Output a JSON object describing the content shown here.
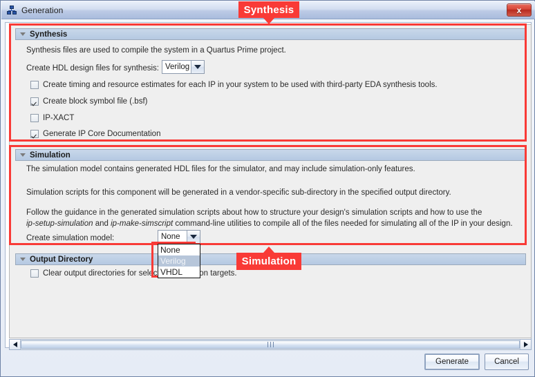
{
  "window": {
    "title": "Generation",
    "icon": "hierarchy-icon",
    "close_label": "x"
  },
  "callouts": [
    {
      "label": "Synthesis"
    },
    {
      "label": "Simulation"
    }
  ],
  "sections": {
    "synthesis": {
      "title": "Synthesis",
      "description": "Synthesis files are used to compile the system in a Quartus Prime project.",
      "hdl_label": "Create HDL design files for synthesis:",
      "hdl_value": "Verilog",
      "checkboxes": [
        {
          "label": "Create timing and resource estimates for each IP in your system to be used with third-party EDA synthesis tools.",
          "checked": false
        },
        {
          "label": "Create block symbol file (.bsf)",
          "checked": true
        },
        {
          "label": "IP-XACT",
          "checked": false
        },
        {
          "label": "Generate IP Core Documentation",
          "checked": true
        }
      ]
    },
    "simulation": {
      "title": "Simulation",
      "paragraph1": "The simulation model contains generated HDL files for the simulator, and may include simulation-only features.",
      "paragraph2": "Simulation scripts for this component will be generated in a vendor-specific sub-directory in the specified output directory.",
      "paragraph3a": "Follow the guidance in the generated simulation scripts about how to structure your design's simulation scripts and how to use the",
      "paragraph3b_italic1": "ip-setup-simulation",
      "paragraph3b_mid": " and ",
      "paragraph3b_italic2": "ip-make-simscript",
      "paragraph3b_end": " command-line utilities to compile all of the files needed for simulating all of the IP in your design.",
      "model_label": "Create simulation model:",
      "model_value": "None",
      "model_options": [
        {
          "label": "None",
          "selected": false
        },
        {
          "label": "Verilog",
          "selected": true
        },
        {
          "label": "VHDL",
          "selected": false
        }
      ]
    },
    "output_directory": {
      "title": "Output Directory",
      "checkbox": {
        "label": "Clear output directories for selected generation targets.",
        "checked": false
      }
    }
  },
  "footer": {
    "generate_label": "Generate",
    "cancel_label": "Cancel"
  },
  "colors": {
    "accent_red": "#f93a36",
    "group_header": "#bed0e6",
    "panel_bg": "#efefef"
  }
}
